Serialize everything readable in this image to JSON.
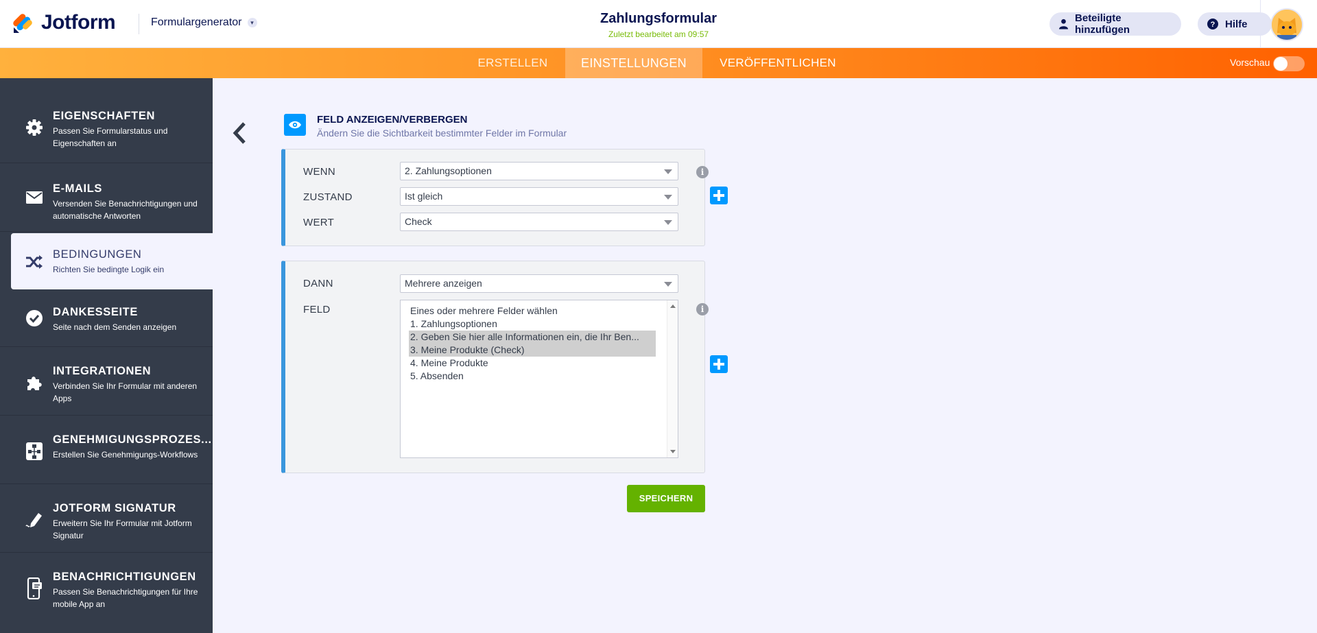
{
  "header": {
    "logo_text": "Jotform",
    "form_builder_label": "Formulargenerator",
    "form_title": "Zahlungsformular",
    "last_edited": "Zuletzt bearbeitet am 09:57",
    "add_collaborators": "Beteiligte hinzufügen",
    "help": "Hilfe"
  },
  "nav": {
    "tabs": [
      {
        "label": "ERSTELLEN"
      },
      {
        "label": "EINSTELLUNGEN",
        "active": true
      },
      {
        "label": "VERÖFFENTLICHEN"
      }
    ],
    "preview_label": "Vorschau",
    "preview_on": false
  },
  "sidebar": {
    "items": [
      {
        "title": "EIGENSCHAFTEN",
        "desc": "Passen Sie Formularstatus und Eigenschaften an",
        "icon": "gear-icon"
      },
      {
        "title": "E-MAILS",
        "desc": "Versenden Sie Benachrichtigungen und automatische Antworten",
        "icon": "mail-icon"
      },
      {
        "title": "BEDINGUNGEN",
        "desc": "Richten Sie bedingte Logik ein",
        "icon": "shuffle-icon",
        "active": true
      },
      {
        "title": "DANKESSEITE",
        "desc": "Seite nach dem Senden anzeigen",
        "icon": "check-circle-icon"
      },
      {
        "title": "INTEGRATIONEN",
        "desc": "Verbinden Sie Ihr Formular mit anderen Apps",
        "icon": "puzzle-icon"
      },
      {
        "title": "GENEHMIGUNGSPROZES...",
        "desc": "Erstellen Sie Genehmigungs-Workflows",
        "icon": "workflow-icon"
      },
      {
        "title": "JOTFORM SIGNATUR",
        "desc": "Erweitern Sie Ihr Formular mit Jotform Signatur",
        "icon": "pen-icon"
      },
      {
        "title": "BENACHRICHTIGUNGEN",
        "desc": "Passen Sie Benachrichtigungen für Ihre mobile App an",
        "icon": "mobile-icon"
      }
    ]
  },
  "panel": {
    "title": "FELD ANZEIGEN/VERBERGEN",
    "subtitle": "Ändern Sie die Sichtbarkeit bestimmter Felder im Formular",
    "condition": {
      "if_label": "WENN",
      "if_value": "2. Zahlungsoptionen",
      "state_label": "ZUSTAND",
      "state_value": "Ist gleich",
      "value_label": "WERT",
      "value_value": "Check"
    },
    "action": {
      "then_label": "DANN",
      "then_value": "Mehrere anzeigen",
      "field_label": "FELD",
      "options": [
        {
          "label": "Eines oder mehrere Felder wählen",
          "selected": false
        },
        {
          "label": "1. Zahlungsoptionen",
          "selected": false
        },
        {
          "label": "2. Geben Sie hier alle Informationen ein, die Ihr Ben...",
          "selected": true
        },
        {
          "label": "3. Meine Produkte (Check)",
          "selected": true
        },
        {
          "label": "4. Meine Produkte",
          "selected": false
        },
        {
          "label": "5. Absenden",
          "selected": false
        }
      ]
    },
    "info_glyph": "i",
    "save_label": "SPEICHERN"
  },
  "colors": {
    "accent_blue": "#0099ff",
    "save_green": "#64b200",
    "orange_start": "#ffb13d",
    "orange_end": "#ff6100",
    "sidebar_bg": "#343c4a"
  }
}
